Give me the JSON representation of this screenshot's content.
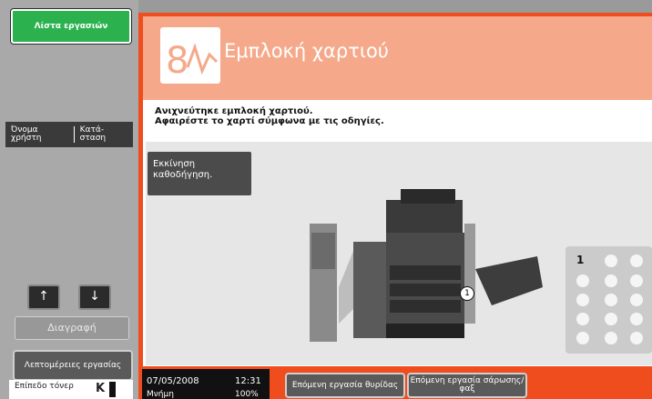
{
  "sidebar": {
    "job_list_button": "Λίστα εργασιών",
    "col_user": "Όνομα χρήστη",
    "col_status": "Κατά-σταση",
    "delete_button": "Διαγραφή",
    "details_button": "Λεπτομέρειες εργασίας",
    "toner_label": "Επίπεδο τόνερ",
    "toner_color": "K"
  },
  "main": {
    "title": "Εμπλοκή χαρτιού",
    "message_line1": "Ανιχνεύτηκε εμπλοκή χαρτιού.",
    "message_line2": "Αφαιρέστε το χαρτί σύμφωνα με τις οδηγίες.",
    "guidance_button": "Εκκίνηση καθοδήγηση.",
    "jam_location_number": "1",
    "panel_number": "1"
  },
  "status_bar": {
    "date": "07/05/2008",
    "time": "12:31",
    "memory_label": "Μνήμη",
    "memory_value": "100%",
    "next_job_tray": "Επόμενη εργασία θυρίδας",
    "next_job_scan": "Επόμενη εργασία σάρωσης/φαξ"
  },
  "colors": {
    "accent": "#f04d1e",
    "header": "#f5a98a",
    "green": "#2bb24f"
  }
}
